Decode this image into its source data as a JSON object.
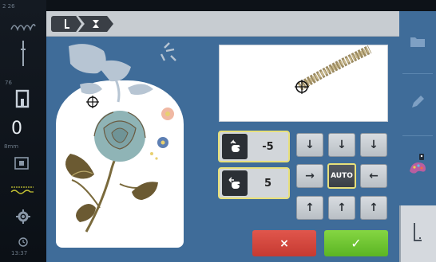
{
  "status_bar": {
    "top_left_text": "2 26",
    "mid_number": "76",
    "needle_value": "0",
    "needle_unit": "8mm",
    "bottom_time_icon": "clock-icon",
    "bottom_time_text": "13:37"
  },
  "breadcrumb": {
    "step1_icon": "needle-icon",
    "step2_icon": "hoop-icon"
  },
  "controls": {
    "vertical_value": "-5",
    "horizontal_value": "5",
    "auto_label": "AUTO",
    "cancel_symbol": "×",
    "confirm_symbol": "✓"
  },
  "arrows": {
    "down": "↓",
    "up": "↑",
    "right": "→",
    "left": "←"
  },
  "colors": {
    "accent_blue": "#3f6c99",
    "highlight_yellow": "#e8e07a",
    "cancel_red": "#d2473e",
    "confirm_green": "#6cc431"
  }
}
